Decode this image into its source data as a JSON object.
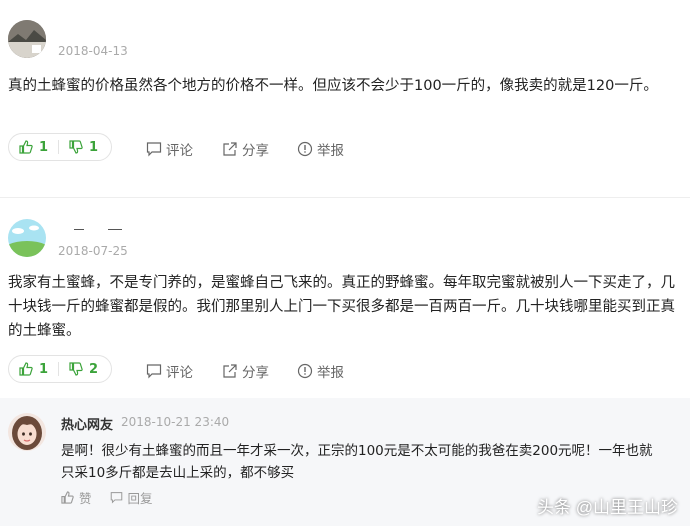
{
  "comments": [
    {
      "username": "",
      "date": "2018-04-13",
      "text": "真的土蜂蜜的价格虽然各个地方的价格不一样。但应该不会少于100一斤的，像我卖的就是120一斤。",
      "likes": "1",
      "dislikes": "1",
      "reply_label": "评论",
      "share_label": "分享",
      "report_label": "举报"
    },
    {
      "username": "",
      "date": "2018-07-25",
      "text": "我家有土蜜蜂，不是专门养的，是蜜蜂自己飞来的。真正的野蜂蜜。每年取完蜜就被别人一下买走了，几十块钱一斤的蜂蜜都是假的。我们那里别人上门一下买很多都是一百两百一斤。几十块钱哪里能买到正真的土蜂蜜。",
      "likes": "1",
      "dislikes": "2",
      "reply_label": "评论",
      "share_label": "分享",
      "report_label": "举报"
    }
  ],
  "reply": {
    "username": "热心网友",
    "date": "2018-10-21 23:40",
    "text": "是啊！很少有土蜂蜜的而且一年才采一次，正宗的100元是不太可能的我爸在卖200元呢！一年也就只采10多斤都是去山上采的，都不够买",
    "like_label": "赞",
    "reply_label": "回复"
  },
  "watermark": "头条 @山里王山珍",
  "colors": {
    "accent_green": "#3ba33a",
    "reply_bg": "#f6f7f9"
  }
}
